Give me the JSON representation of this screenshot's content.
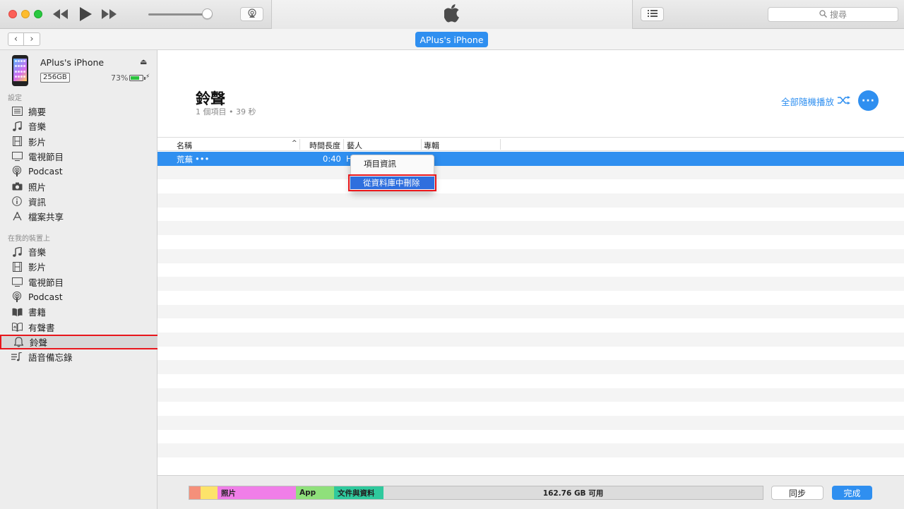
{
  "window": {
    "search_placeholder": "搜尋",
    "device_pill": "APlus's iPhone"
  },
  "sidebar": {
    "device": {
      "name": "APlus's iPhone",
      "capacity": "256GB",
      "battery": "73%",
      "battery_level": 0.73
    },
    "settings_label": "設定",
    "settings_items": [
      {
        "label": "摘要",
        "icon": "summary-icon"
      },
      {
        "label": "音樂",
        "icon": "music-note-icon"
      },
      {
        "label": "影片",
        "icon": "film-icon"
      },
      {
        "label": "電視節目",
        "icon": "tv-icon"
      },
      {
        "label": "Podcast",
        "icon": "podcast-icon"
      },
      {
        "label": "照片",
        "icon": "camera-icon"
      },
      {
        "label": "資訊",
        "icon": "info-icon"
      },
      {
        "label": "檔案共享",
        "icon": "file-sharing-icon"
      }
    ],
    "ondevice_label": "在我的裝置上",
    "ondevice_items": [
      {
        "label": "音樂",
        "icon": "music-note-icon"
      },
      {
        "label": "影片",
        "icon": "film-icon"
      },
      {
        "label": "電視節目",
        "icon": "tv-icon"
      },
      {
        "label": "Podcast",
        "icon": "podcast-icon"
      },
      {
        "label": "書籍",
        "icon": "book-icon"
      },
      {
        "label": "有聲書",
        "icon": "audiobook-icon"
      },
      {
        "label": "鈴聲",
        "icon": "bell-icon"
      },
      {
        "label": "語音備忘錄",
        "icon": "voice-memo-icon"
      }
    ]
  },
  "main": {
    "title": "鈴聲",
    "subtitle": "1 個項目 • 39 秒",
    "shuffle_label": "全部隨機播放",
    "columns": {
      "name": "名稱",
      "duration": "時間長度",
      "artist": "藝人",
      "album": "專輯"
    },
    "selected_row": {
      "name": "荒蕪",
      "more": "•••",
      "duration": "0:40",
      "artist": "H"
    }
  },
  "context_menu": {
    "items": [
      {
        "label": "項目資訊"
      },
      {
        "label": "從資料庫中刪除"
      }
    ]
  },
  "storage": {
    "segments": [
      {
        "label": "",
        "color": "#f5907a"
      },
      {
        "label": "",
        "color": "#fde36a"
      },
      {
        "label": "照片",
        "color": "#f07ee8"
      },
      {
        "label": "App",
        "color": "#8fe07b"
      },
      {
        "label": "文件與資料",
        "color": "#2fc99d"
      }
    ],
    "free_label": "162.76 GB 可用"
  },
  "buttons": {
    "sync": "同步",
    "done": "完成"
  },
  "colors": {
    "accent": "#2f8ff0",
    "highlight_box": "#e8161c"
  }
}
